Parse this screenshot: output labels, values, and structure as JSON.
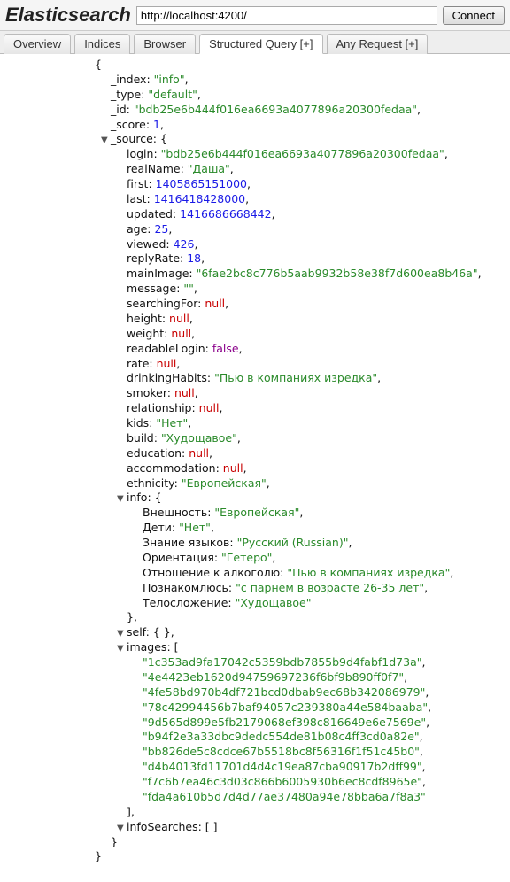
{
  "header": {
    "brand": "Elasticsearch",
    "url": "http://localhost:4200/",
    "connect_label": "Connect"
  },
  "tabs": {
    "overview": "Overview",
    "indices": "Indices",
    "browser": "Browser",
    "structured": "Structured Query [+]",
    "anyreq": "Any Request [+]"
  },
  "doc": {
    "_index": "info",
    "_type": "default",
    "_id": "bdb25e6b444f016ea6693a4077896a20300fedaa",
    "_score": 1,
    "_source": {
      "login": "bdb25e6b444f016ea6693a4077896a20300fedaa",
      "realName": "Даша",
      "first": 1405865151000,
      "last": 1416418428000,
      "updated": 1416686668442,
      "age": 25,
      "viewed": 426,
      "replyRate": 18,
      "mainImage": "6fae2bc8c776b5aab9932b58e38f7d600ea8b46a",
      "message": "",
      "searchingFor": null,
      "height": null,
      "weight": null,
      "readableLogin": false,
      "rate": null,
      "drinkingHabits": "Пью в компаниях изредка",
      "smoker": null,
      "relationship": null,
      "kids": "Нет",
      "build": "Худощавое",
      "education": null,
      "accommodation": null,
      "ethnicity": "Европейская",
      "info": {
        "Внешность": "Европейская",
        "Дети": "Нет",
        "Знание языков": "Русский (Russian)",
        "Ориентация": "Гетеро",
        "Отношение к алкоголю": "Пью в компаниях изредка",
        "Познакомлюсь": "с парнем в возрасте 26-35 лет",
        "Телосложение": "Худощавое"
      },
      "self_label": "self",
      "images": [
        "1c353ad9fa17042c5359bdb7855b9d4fabf1d73a",
        "4e4423eb1620d94759697236f6bf9b890ff0f7",
        "4fe58bd970b4df721bcd0dbab9ec68b342086979",
        "78c42994456b7baf94057c239380a44e584baaba",
        "9d565d899e5fb2179068ef398c816649e6e7569e",
        "b94f2e3a33dbc9dedc554de81b08c4ff3cd0a82e",
        "bb826de5c8cdce67b5518bc8f56316f1f51c45b0",
        "d4b4013fd11701d4d4c19ea87cba90917b2dff99",
        "f7c6b7ea46c3d03c866b6005930b6ec8cdf8965e",
        "fda4a610b5d7d4d77ae37480a94e78bba6a7f8a3"
      ],
      "infoSearches_label": "infoSearches"
    }
  }
}
